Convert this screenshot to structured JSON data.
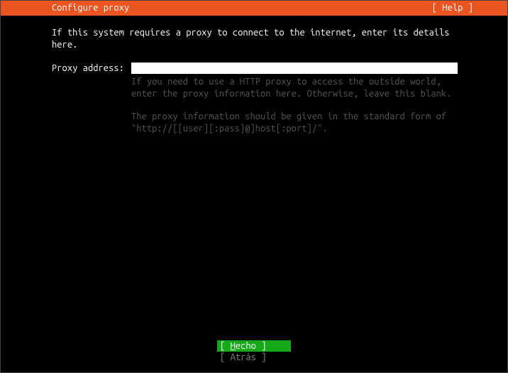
{
  "header": {
    "title": "Configure proxy",
    "help": "[ Help ]"
  },
  "intro": "If this system requires a proxy to connect to the internet, enter its details here.",
  "form": {
    "proxy_label": "Proxy address:",
    "proxy_value": "",
    "help_line1": "If you need to use a HTTP proxy to access the outside world, enter the proxy information here. Otherwise, leave this blank.",
    "help_line2": "The proxy information should be given in the standard form of \"http://[[user][:pass]@]host[:port]/\"."
  },
  "buttons": {
    "done_prefix": "[ ",
    "done_hotkey": "H",
    "done_rest": "echo",
    "done_suffix": "    ]",
    "back_prefix": "[ ",
    "back_label": "Atrás",
    "back_suffix": "    ]"
  }
}
